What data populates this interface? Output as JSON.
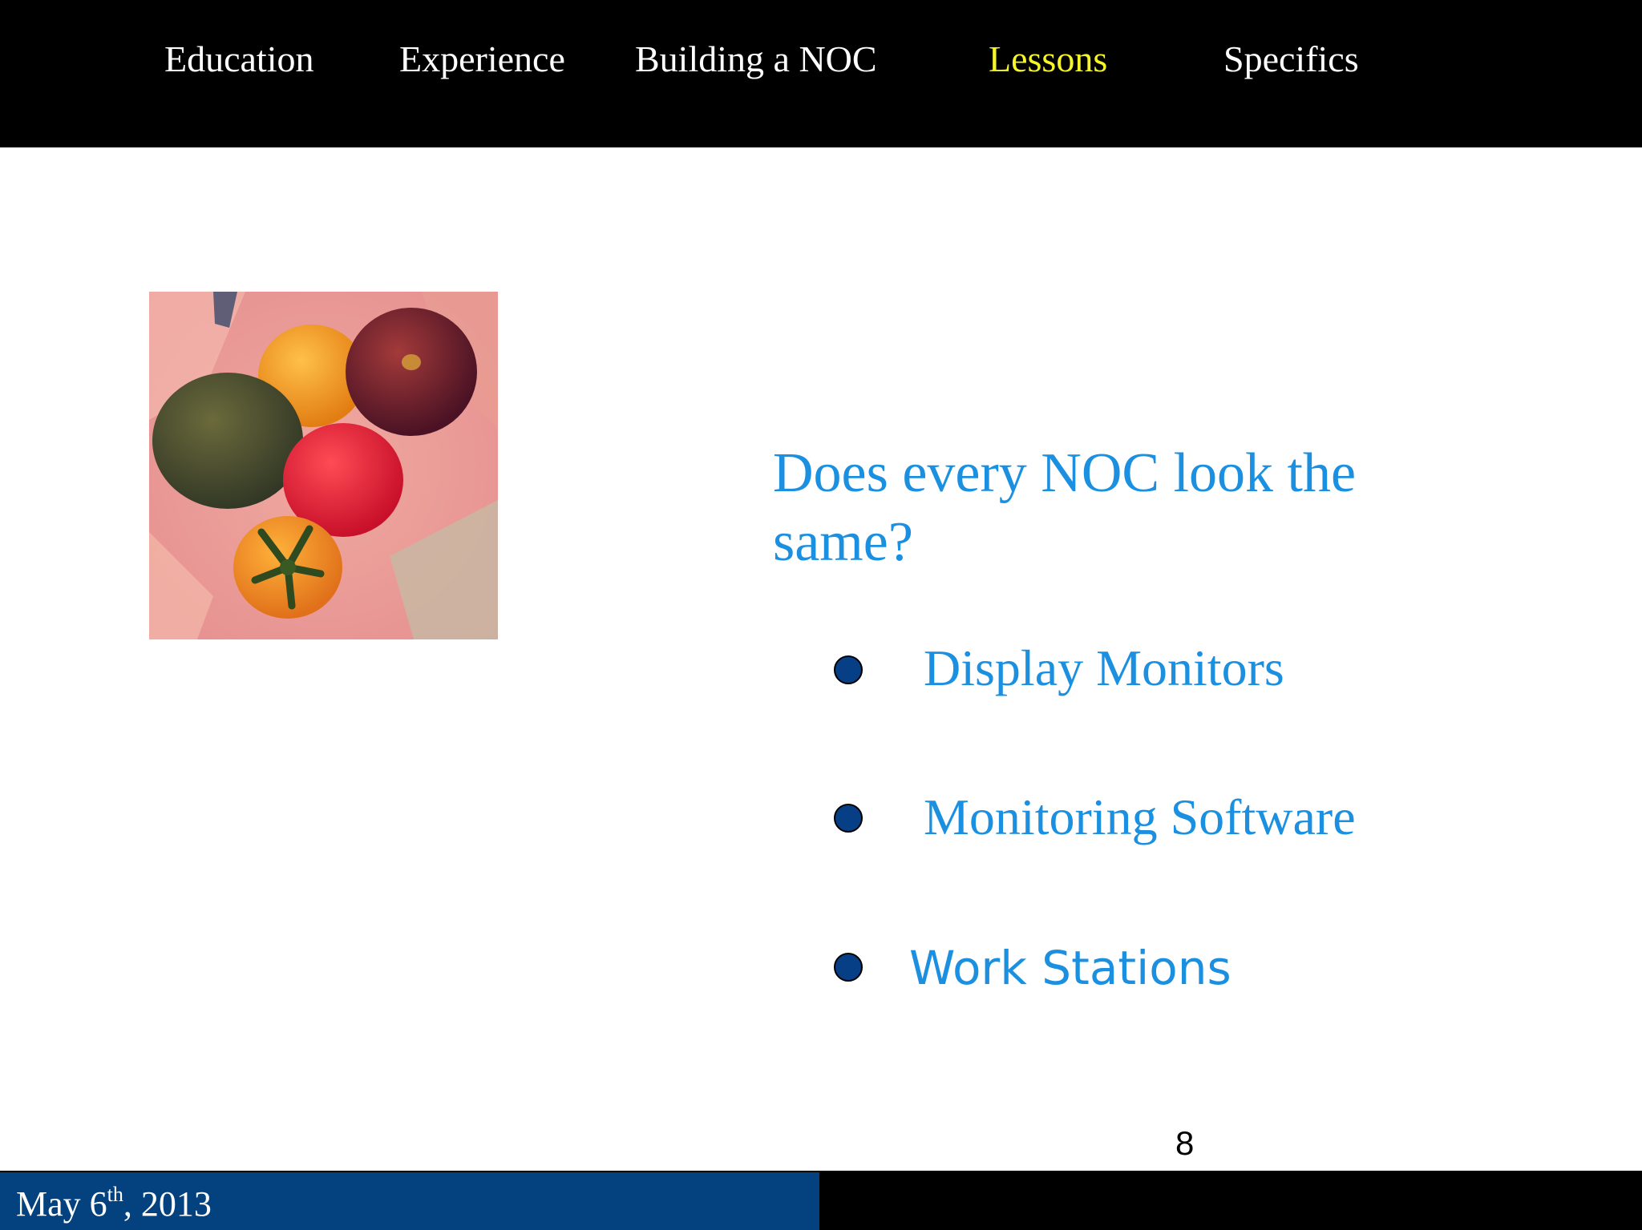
{
  "nav": {
    "items": [
      {
        "label": "Education",
        "active": false
      },
      {
        "label": "Experience",
        "active": false
      },
      {
        "label": "Building a NOC",
        "active": false
      },
      {
        "label": "Lessons",
        "active": true
      },
      {
        "label": "Specifics",
        "active": false
      }
    ],
    "active_color": "#f5f52a"
  },
  "slide": {
    "question": "Does every NOC look the same?",
    "bullets": [
      {
        "label": "Display Monitors"
      },
      {
        "label": "Monitoring Software"
      },
      {
        "label": "Work Stations"
      }
    ],
    "page_number": "8",
    "image_icon": "tomatoes-photo-icon"
  },
  "footer": {
    "date_prefix": "May 6",
    "date_suffix": "th",
    "date_rest": ", 2013"
  },
  "colors": {
    "accent_text": "#1b90e0",
    "bullet": "#073f86",
    "footer_box": "#03427f"
  }
}
